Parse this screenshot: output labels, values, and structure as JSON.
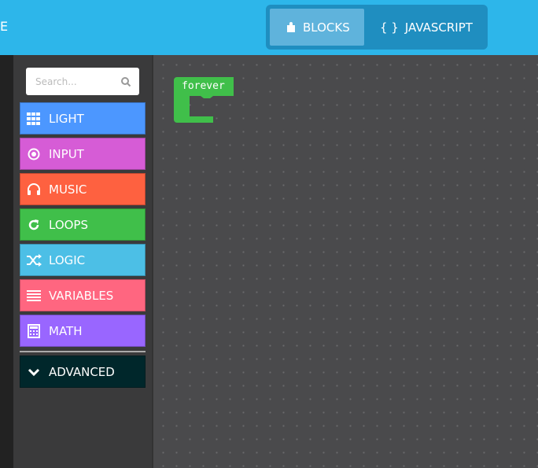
{
  "header": {
    "edge_text": "E",
    "modes": {
      "blocks_label": "BLOCKS",
      "javascript_label": "JAVASCRIPT",
      "javascript_icon_text": "{ }"
    }
  },
  "search": {
    "placeholder": "Search..."
  },
  "categories": [
    {
      "label": "LIGHT",
      "color": "#4c97ff",
      "icon": "grid-icon"
    },
    {
      "label": "INPUT",
      "color": "#d65cd6",
      "icon": "target-icon"
    },
    {
      "label": "MUSIC",
      "color": "#fe6140",
      "icon": "headphones-icon"
    },
    {
      "label": "LOOPS",
      "color": "#40bf4a",
      "icon": "refresh-icon"
    },
    {
      "label": "LOGIC",
      "color": "#4cbfe6",
      "icon": "shuffle-icon"
    },
    {
      "label": "VARIABLES",
      "color": "#ff6680",
      "icon": "list-icon"
    },
    {
      "label": "MATH",
      "color": "#9966ff",
      "icon": "calculator-icon"
    }
  ],
  "advanced": {
    "label": "ADVANCED",
    "color": "#00272b",
    "icon": "chevron-down-icon"
  },
  "workspace": {
    "block": {
      "label": "forever",
      "color": "#40bf4a"
    }
  }
}
